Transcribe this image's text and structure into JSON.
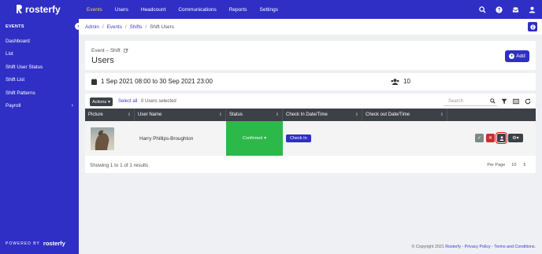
{
  "brand": {
    "name": "rosterfy"
  },
  "nav": [
    "Events",
    "Users",
    "Headcount",
    "Communications",
    "Reports",
    "Settings"
  ],
  "nav_active": "Events",
  "icons": {
    "search": "search-icon",
    "help": "help-icon",
    "inbox": "inbox-icon",
    "account": "account-icon"
  },
  "sidebar": {
    "section": "EVENTS",
    "items": [
      {
        "label": "Dashboard"
      },
      {
        "label": "List"
      },
      {
        "label": "Shift User Status"
      },
      {
        "label": "Shift List"
      },
      {
        "label": "Shift Patterns"
      },
      {
        "label": "Payroll"
      }
    ],
    "powered_by": "POWERED BY",
    "powered_brand": "rosterfy"
  },
  "breadcrumb": [
    "Admin",
    "Events",
    "Shifts",
    "Shift Users"
  ],
  "header": {
    "subtitle": "Event – Shift",
    "title": "Users",
    "add_label": "Add"
  },
  "shift": {
    "dates": "1 Sep 2021 08:00 to 30 Sep 2021 23:00",
    "users_count": "10"
  },
  "toolbar": {
    "actions_label": "Actions",
    "select_all": "Select all",
    "selected": "0 Users selected",
    "search_placeholder": "Search"
  },
  "table": {
    "columns": [
      "Picture",
      "User Name",
      "Status",
      "Check In Date/Time",
      "Check out Date/Time",
      ""
    ],
    "rows": [
      {
        "user_name": "Harry Phillips-Broughton",
        "status": "Confirmed",
        "check_in_label": "Check In"
      }
    ]
  },
  "footer": {
    "showing": "Showing 1 to 1 of 1 results",
    "per_page_label": "Per Page",
    "per_page_value": "10"
  },
  "copyright": {
    "text": "© Copyright 2021",
    "brand": "Rosterfy",
    "privacy": "Privacy Policy",
    "terms": "Terms and Conditions."
  },
  "colors": {
    "brand": "#2f2fc6",
    "active_nav": "#f3d34a",
    "confirmed": "#2db84a",
    "header_dark": "#3c4047"
  }
}
